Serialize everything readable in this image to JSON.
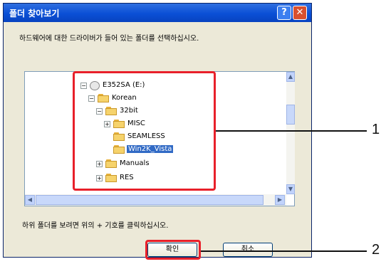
{
  "dialog": {
    "title": "폴더 찾아보기",
    "help_label": "?",
    "close_label": "✕",
    "instruction": "하드웨어에 대한 드라이버가 들어 있는 폴더를 선택하십시오.",
    "hint": "하위 폴더를 보려면 위의 + 기호를 클릭하십시오.",
    "ok_label": "확인",
    "cancel_label": "취소"
  },
  "tree": {
    "items": [
      {
        "label": "E352SA (E:)",
        "expander": "−",
        "icon": "drive-icon"
      },
      {
        "label": "Korean",
        "expander": "−",
        "icon": "folder-icon"
      },
      {
        "label": "32bit",
        "expander": "−",
        "icon": "folder-icon"
      },
      {
        "label": "MISC",
        "expander": "+",
        "icon": "folder-icon"
      },
      {
        "label": "SEAMLESS",
        "expander": "",
        "icon": "folder-icon"
      },
      {
        "label": "Win2K_Vista",
        "expander": "",
        "icon": "folder-icon",
        "selected": true
      },
      {
        "label": "Manuals",
        "expander": "+",
        "icon": "folder-icon"
      },
      {
        "label": "RES",
        "expander": "+",
        "icon": "folder-icon"
      }
    ]
  },
  "callouts": {
    "one": "1",
    "two": "2"
  }
}
